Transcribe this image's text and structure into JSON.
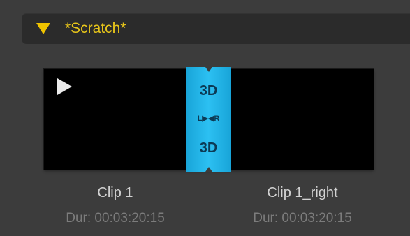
{
  "bin": {
    "name": "*Scratch*",
    "expanded": true,
    "disclosure_icon": "triangle-down-icon",
    "accent_color": "#f0c400"
  },
  "clip": {
    "play_icon": "play-icon",
    "stereo_badge": {
      "top_label": "3D",
      "middle_label": "L▶◀R",
      "bottom_label": "3D",
      "color": "#2cc0f2"
    },
    "left": {
      "name": "Clip 1",
      "duration": "Dur: 00:03:20:15"
    },
    "right": {
      "name": "Clip 1_right",
      "duration": "Dur: 00:03:20:15"
    }
  }
}
